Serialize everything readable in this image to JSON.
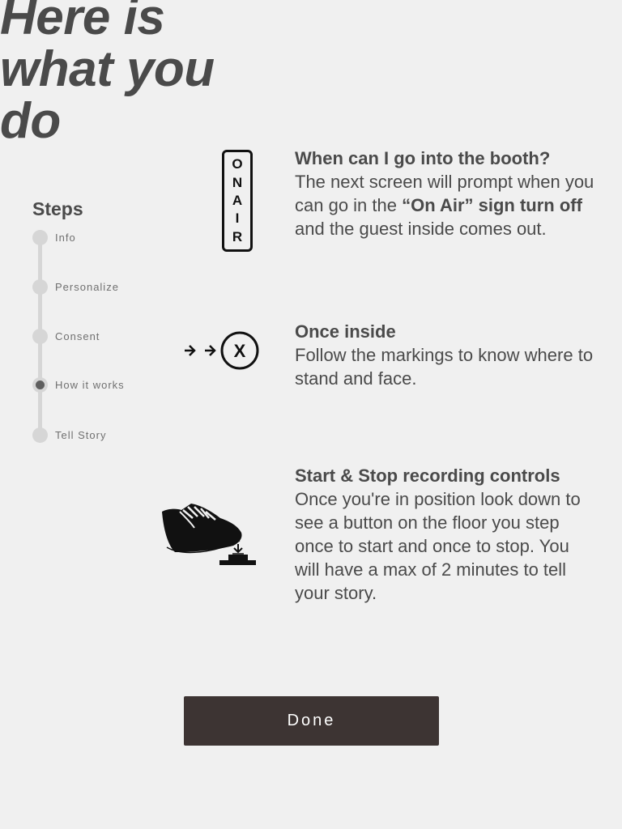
{
  "title": {
    "line1": "Here is",
    "line2": "what you",
    "line3": "do"
  },
  "steps": {
    "heading": "Steps",
    "items": [
      {
        "label": "Info",
        "active": false
      },
      {
        "label": "Personalize",
        "active": false
      },
      {
        "label": "Consent",
        "active": false
      },
      {
        "label": "How it works",
        "active": true
      },
      {
        "label": "Tell Story",
        "active": false
      }
    ]
  },
  "sections": {
    "booth": {
      "icon": "on-air-sign-icon",
      "sign_letters": [
        "O",
        "N",
        "A",
        "I",
        "R"
      ],
      "heading": "When can I go into the booth?",
      "text_before": "The next screen will prompt when you can go in the ",
      "text_bold": "“On Air” sign turn off",
      "text_after": " and the guest inside comes out."
    },
    "inside": {
      "icon": "floor-marking-icon",
      "mark_letter": "X",
      "heading": "Once inside",
      "text": "Follow the markings to know where to stand and face."
    },
    "controls": {
      "icon": "foot-pedal-icon",
      "heading": "Start & Stop recording controls",
      "text": "Once you're in position look down to see a button on the floor you step once to start and once to stop. You will have a max of 2 minutes to tell your story."
    }
  },
  "done_button": {
    "label": "Done"
  },
  "colors": {
    "background": "#f0f0f0",
    "text": "#4a4a4a",
    "button": "#3d3433",
    "button_text": "#ffffff",
    "step_track": "#d6d6d6",
    "step_active": "#5e5e5e"
  }
}
